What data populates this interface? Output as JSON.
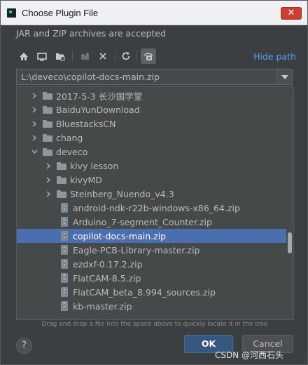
{
  "window": {
    "title": "Choose Plugin File",
    "close_glyph": "✕"
  },
  "description": "JAR and ZIP archives are accepted",
  "toolbar": {
    "icons": [
      "home-icon",
      "desktop-icon",
      "project-icon",
      "new-folder-icon",
      "delete-icon",
      "refresh-icon",
      "show-hidden-icon"
    ],
    "hide_path_label": "Hide path"
  },
  "path": {
    "value": "L:\\deveco\\copilot-docs-main.zip"
  },
  "tree": [
    {
      "label": "2017-5-3 长沙国学堂",
      "type": "folder",
      "expanded": false,
      "level": 0
    },
    {
      "label": "BaiduYunDownload",
      "type": "folder",
      "expanded": false,
      "level": 0
    },
    {
      "label": "BluestacksCN",
      "type": "folder",
      "expanded": false,
      "level": 0
    },
    {
      "label": "chang",
      "type": "folder",
      "expanded": false,
      "level": 0
    },
    {
      "label": "deveco",
      "type": "folder",
      "expanded": true,
      "level": 0
    },
    {
      "label": "kivy lesson",
      "type": "folder",
      "expanded": false,
      "level": 1
    },
    {
      "label": "kivyMD",
      "type": "folder",
      "expanded": false,
      "level": 1
    },
    {
      "label": "Steinberg_Nuendo_v4.3",
      "type": "folder",
      "expanded": false,
      "level": 1
    },
    {
      "label": "android-ndk-r22b-windows-x86_64.zip",
      "type": "zip",
      "level": 1
    },
    {
      "label": "Arduino_7-segment_Counter.zip",
      "type": "zip",
      "level": 1
    },
    {
      "label": "copilot-docs-main.zip",
      "type": "zip",
      "level": 1,
      "selected": true
    },
    {
      "label": "Eagle-PCB-Library-master.zip",
      "type": "zip",
      "level": 1
    },
    {
      "label": "ezdxf-0.17.2.zip",
      "type": "zip",
      "level": 1
    },
    {
      "label": "FlatCAM-8.5.zip",
      "type": "zip",
      "level": 1
    },
    {
      "label": "FlatCAM_beta_8.994_sources.zip",
      "type": "zip",
      "level": 1
    },
    {
      "label": "kb-master.zip",
      "type": "zip",
      "level": 1
    }
  ],
  "hint": "Drag and drop a file into the space above to quickly locate it in the tree",
  "buttons": {
    "help": "?",
    "ok": "OK",
    "cancel": "Cancel"
  },
  "watermark": "CSDN @河西石头",
  "colors": {
    "background": "#3c3f41",
    "selection": "#4b6eaf",
    "link": "#589df6",
    "ok_button": "#365880"
  }
}
